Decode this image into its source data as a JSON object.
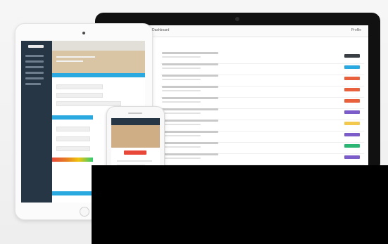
{
  "laptop": {
    "app_title": "Dashboard",
    "user_label": "Profile",
    "tasks": [
      {
        "badge_color": "#3a3f46"
      },
      {
        "badge_color": "#2aa8e0"
      },
      {
        "badge_color": "#e8603c"
      },
      {
        "badge_color": "#e8603c"
      },
      {
        "badge_color": "#e8603c"
      },
      {
        "badge_color": "#7b5cc8"
      },
      {
        "badge_color": "#f2c94c"
      },
      {
        "badge_color": "#7b5cc8"
      },
      {
        "badge_color": "#2bb673"
      },
      {
        "badge_color": "#7b5cc8"
      }
    ],
    "cta_color": "#2bb673"
  },
  "tablet": {
    "sidebar_color": "#273645",
    "strip_color": "#2aa8e0",
    "progress_caption": ""
  },
  "phone": {
    "hero_text": "",
    "button_color": "#e8473a"
  },
  "overlay": {
    "color": "#000000"
  }
}
